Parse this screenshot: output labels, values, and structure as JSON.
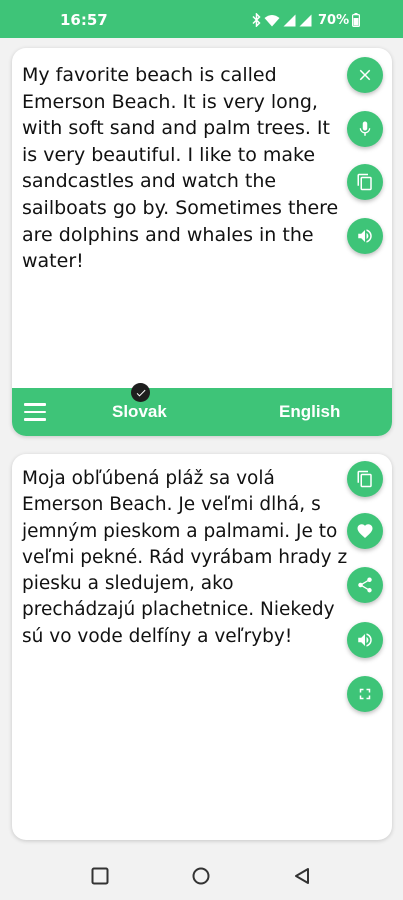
{
  "status_bar": {
    "time": "16:57",
    "battery_percent": "70%",
    "icons": [
      "bluetooth-icon",
      "wifi-icon",
      "signal-icon",
      "signal-icon",
      "battery-icon"
    ]
  },
  "colors": {
    "accent": "#3ec478",
    "text": "#111111",
    "background": "#f2f2f2"
  },
  "source": {
    "text": "My favorite beach is called Emerson Beach. It is very long, with soft sand and palm trees. It is very beautiful. I like to make sandcastles and watch the sailboats go by. Sometimes there are dolphins and whales in the water!",
    "buttons": [
      "clear-icon",
      "mic-icon",
      "copy-icon",
      "speaker-icon"
    ]
  },
  "language_bar": {
    "source_language": "Slovak",
    "target_language": "English"
  },
  "target": {
    "text": "Moja obľúbená pláž sa volá Emerson Beach. Je veľmi dlhá, s jemným pieskom a palmami. Je to veľmi pekné. Rád vyrábam hrady z piesku a sledujem, ako prechádzajú plachetnice. Niekedy sú vo vode delfíny a veľryby!",
    "buttons": [
      "copy-icon",
      "heart-icon",
      "share-icon",
      "speaker-icon",
      "fullscreen-icon"
    ]
  },
  "nav_bar": {
    "buttons": [
      "recents-icon",
      "home-icon",
      "back-icon"
    ]
  }
}
